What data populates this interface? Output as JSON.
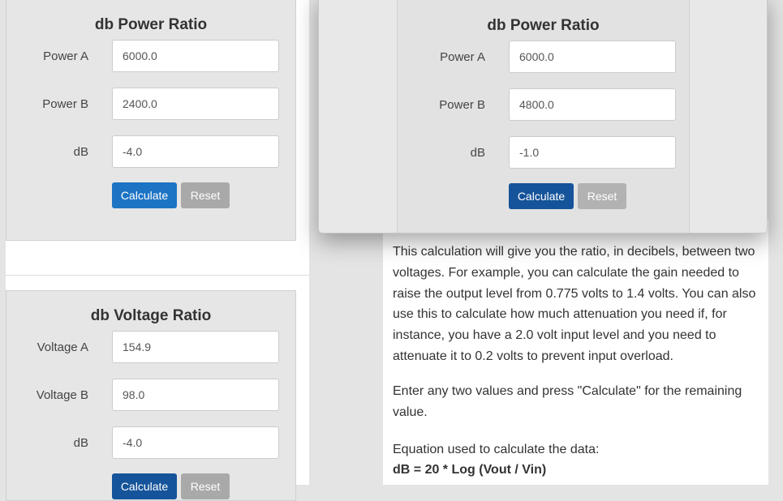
{
  "power_form_left": {
    "title": "db Power Ratio",
    "power_a_label": "Power A",
    "power_a_value": "6000.0",
    "power_b_label": "Power B",
    "power_b_value": "2400.0",
    "db_label": "dB",
    "db_value": "-4.0",
    "calculate": "Calculate",
    "reset": "Reset"
  },
  "voltage_form": {
    "title": "db Voltage Ratio",
    "voltage_a_label": "Voltage A",
    "voltage_a_value": "154.9",
    "voltage_b_label": "Voltage B",
    "voltage_b_value": "98.0",
    "db_label": "dB",
    "db_value": "-4.0",
    "calculate": "Calculate",
    "reset": "Reset"
  },
  "power_form_popup": {
    "title": "db Power Ratio",
    "power_a_label": "Power A",
    "power_a_value": "6000.0",
    "power_b_label": "Power B",
    "power_b_value": "4800.0",
    "db_label": "dB",
    "db_value": "-1.0",
    "calculate": "Calculate",
    "reset": "Reset"
  },
  "description": {
    "paragraph1": "This calculation will give you the ratio, in decibels, between two voltages. For example, you can calculate the gain needed to raise the output level from 0.775 volts to 1.4 volts. You can also use this to calculate how much attenuation you need if, for instance, you have a 2.0 volt input level and you need to attenuate it to 0.2 volts to prevent input overload.",
    "paragraph2": "Enter any two values and press \"Calculate\" for the remaining value.",
    "equation_intro": "Equation used to calculate the data:",
    "equation": "dB = 20 * Log (Vout / Vin)"
  },
  "colors": {
    "calculate_button": "#1d74c4",
    "calculate_button_active": "#15549a",
    "reset_button": "#a9a9a9",
    "panel_background": "#e6e6e6"
  }
}
